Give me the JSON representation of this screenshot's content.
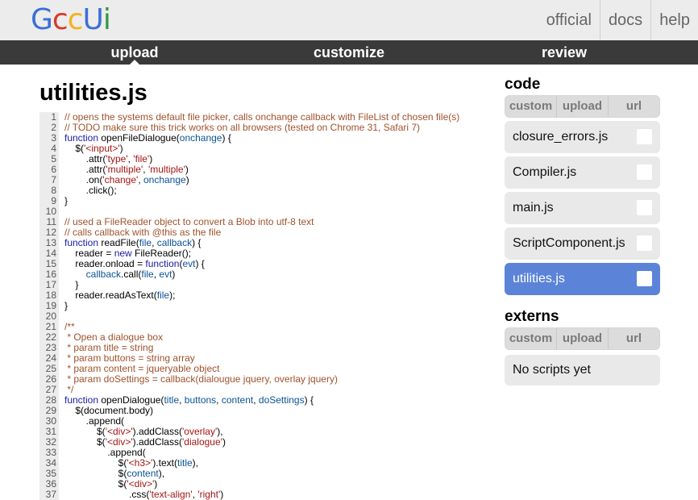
{
  "header": {
    "logo_letters": [
      {
        "char": "G",
        "color": "#3b6fd6"
      },
      {
        "char": "c",
        "color": "#d93a2b"
      },
      {
        "char": "c",
        "color": "#f2b31e"
      },
      {
        "char": "U",
        "color": "#3b6fd6"
      },
      {
        "char": "i",
        "color": "#2d9a3f"
      }
    ],
    "nav": [
      "official",
      "docs",
      "help"
    ]
  },
  "tabs": {
    "upload": "upload",
    "customize": "customize",
    "review": "review"
  },
  "editor": {
    "filename": "utilities.js",
    "lines": [
      [
        [
          "c",
          "// opens the systems default file picker, calls onchange callback with FileList of chosen file(s)"
        ]
      ],
      [
        [
          "c",
          "// TODO make sure this trick works on all browsers (tested on Chrome 31, Safari 7)"
        ]
      ],
      [
        [
          "k",
          "function"
        ],
        [
          "p",
          " openFileDialogue("
        ],
        [
          "v",
          "onchange"
        ],
        [
          "p",
          ") {"
        ]
      ],
      [
        [
          "p",
          "    $("
        ],
        [
          "s",
          "'<input>'"
        ],
        [
          "p",
          ")"
        ]
      ],
      [
        [
          "p",
          "        .attr("
        ],
        [
          "s",
          "'type'"
        ],
        [
          "p",
          ", "
        ],
        [
          "s",
          "'file'"
        ],
        [
          "p",
          ")"
        ]
      ],
      [
        [
          "p",
          "        .attr("
        ],
        [
          "s",
          "'multiple'"
        ],
        [
          "p",
          ", "
        ],
        [
          "s",
          "'multiple'"
        ],
        [
          "p",
          ")"
        ]
      ],
      [
        [
          "p",
          "        .on("
        ],
        [
          "s",
          "'change'"
        ],
        [
          "p",
          ", "
        ],
        [
          "v",
          "onchange"
        ],
        [
          "p",
          ")"
        ]
      ],
      [
        [
          "p",
          "        .click();"
        ]
      ],
      [
        [
          "p",
          "}"
        ]
      ],
      [],
      [
        [
          "c",
          "// used a FileReader object to convert a Blob into utf-8 text"
        ]
      ],
      [
        [
          "c",
          "// calls callback with @this as the file"
        ]
      ],
      [
        [
          "k",
          "function"
        ],
        [
          "p",
          " readFile("
        ],
        [
          "v",
          "file"
        ],
        [
          "p",
          ", "
        ],
        [
          "v",
          "callback"
        ],
        [
          "p",
          ") {"
        ]
      ],
      [
        [
          "p",
          "    reader = "
        ],
        [
          "k",
          "new"
        ],
        [
          "p",
          " FileReader();"
        ]
      ],
      [
        [
          "p",
          "    reader.onload = "
        ],
        [
          "k",
          "function"
        ],
        [
          "p",
          "("
        ],
        [
          "v",
          "evt"
        ],
        [
          "p",
          ") {"
        ]
      ],
      [
        [
          "v",
          "        callback"
        ],
        [
          "p",
          ".call("
        ],
        [
          "v",
          "file"
        ],
        [
          "p",
          ", "
        ],
        [
          "v",
          "evt"
        ],
        [
          "p",
          ")"
        ]
      ],
      [
        [
          "p",
          "    }"
        ]
      ],
      [
        [
          "p",
          "    reader.readAsText("
        ],
        [
          "v",
          "file"
        ],
        [
          "p",
          ");"
        ]
      ],
      [
        [
          "p",
          "}"
        ]
      ],
      [],
      [
        [
          "c",
          "/**"
        ]
      ],
      [
        [
          "c",
          " * Open a dialogue box"
        ]
      ],
      [
        [
          "c",
          " * param title = string"
        ]
      ],
      [
        [
          "c",
          " * param buttons = string array"
        ]
      ],
      [
        [
          "c",
          " * param content = jqueryable object"
        ]
      ],
      [
        [
          "c",
          " * param doSettings = callback(dialougue jquery, overlay jquery)"
        ]
      ],
      [
        [
          "c",
          " */"
        ]
      ],
      [
        [
          "k",
          "function"
        ],
        [
          "p",
          " openDialogue("
        ],
        [
          "v",
          "title"
        ],
        [
          "p",
          ", "
        ],
        [
          "v",
          "buttons"
        ],
        [
          "p",
          ", "
        ],
        [
          "v",
          "content"
        ],
        [
          "p",
          ", "
        ],
        [
          "v",
          "doSettings"
        ],
        [
          "p",
          ") {"
        ]
      ],
      [
        [
          "p",
          "    $(document.body)"
        ]
      ],
      [
        [
          "p",
          "        .append("
        ]
      ],
      [
        [
          "p",
          "            $("
        ],
        [
          "s",
          "'<div>'"
        ],
        [
          "p",
          ").addClass("
        ],
        [
          "s",
          "'overlay'"
        ],
        [
          "p",
          "),"
        ]
      ],
      [
        [
          "p",
          "            $("
        ],
        [
          "s",
          "'<div>'"
        ],
        [
          "p",
          ").addClass("
        ],
        [
          "s",
          "'dialogue'"
        ],
        [
          "p",
          ")"
        ]
      ],
      [
        [
          "p",
          "                .append("
        ]
      ],
      [
        [
          "p",
          "                    $("
        ],
        [
          "s",
          "'<h3>'"
        ],
        [
          "p",
          ").text("
        ],
        [
          "v",
          "title"
        ],
        [
          "p",
          "),"
        ]
      ],
      [
        [
          "p",
          "                    $("
        ],
        [
          "v",
          "content"
        ],
        [
          "p",
          "),"
        ]
      ],
      [
        [
          "p",
          "                    $("
        ],
        [
          "s",
          "'<div>'"
        ],
        [
          "p",
          ")"
        ]
      ],
      [
        [
          "p",
          "                        .css("
        ],
        [
          "s",
          "'text-align'"
        ],
        [
          "p",
          ", "
        ],
        [
          "s",
          "'right'"
        ],
        [
          "p",
          ")"
        ]
      ]
    ]
  },
  "sidebar": {
    "code_heading": "code",
    "code_tabs": [
      "custom",
      "upload",
      "url"
    ],
    "files": [
      {
        "name": "closure_errors.js",
        "selected": false
      },
      {
        "name": "Compiler.js",
        "selected": false
      },
      {
        "name": "main.js",
        "selected": false
      },
      {
        "name": "ScriptComponent.js",
        "selected": false
      },
      {
        "name": "utilities.js",
        "selected": true
      }
    ],
    "externs_heading": "externs",
    "externs_tabs": [
      "custom",
      "upload",
      "url"
    ],
    "externs_empty": "No scripts yet"
  },
  "colors": {
    "selected_file": "#5b83d8",
    "tab_bar": "#3a3a3a",
    "header_bg": "#ececec"
  }
}
